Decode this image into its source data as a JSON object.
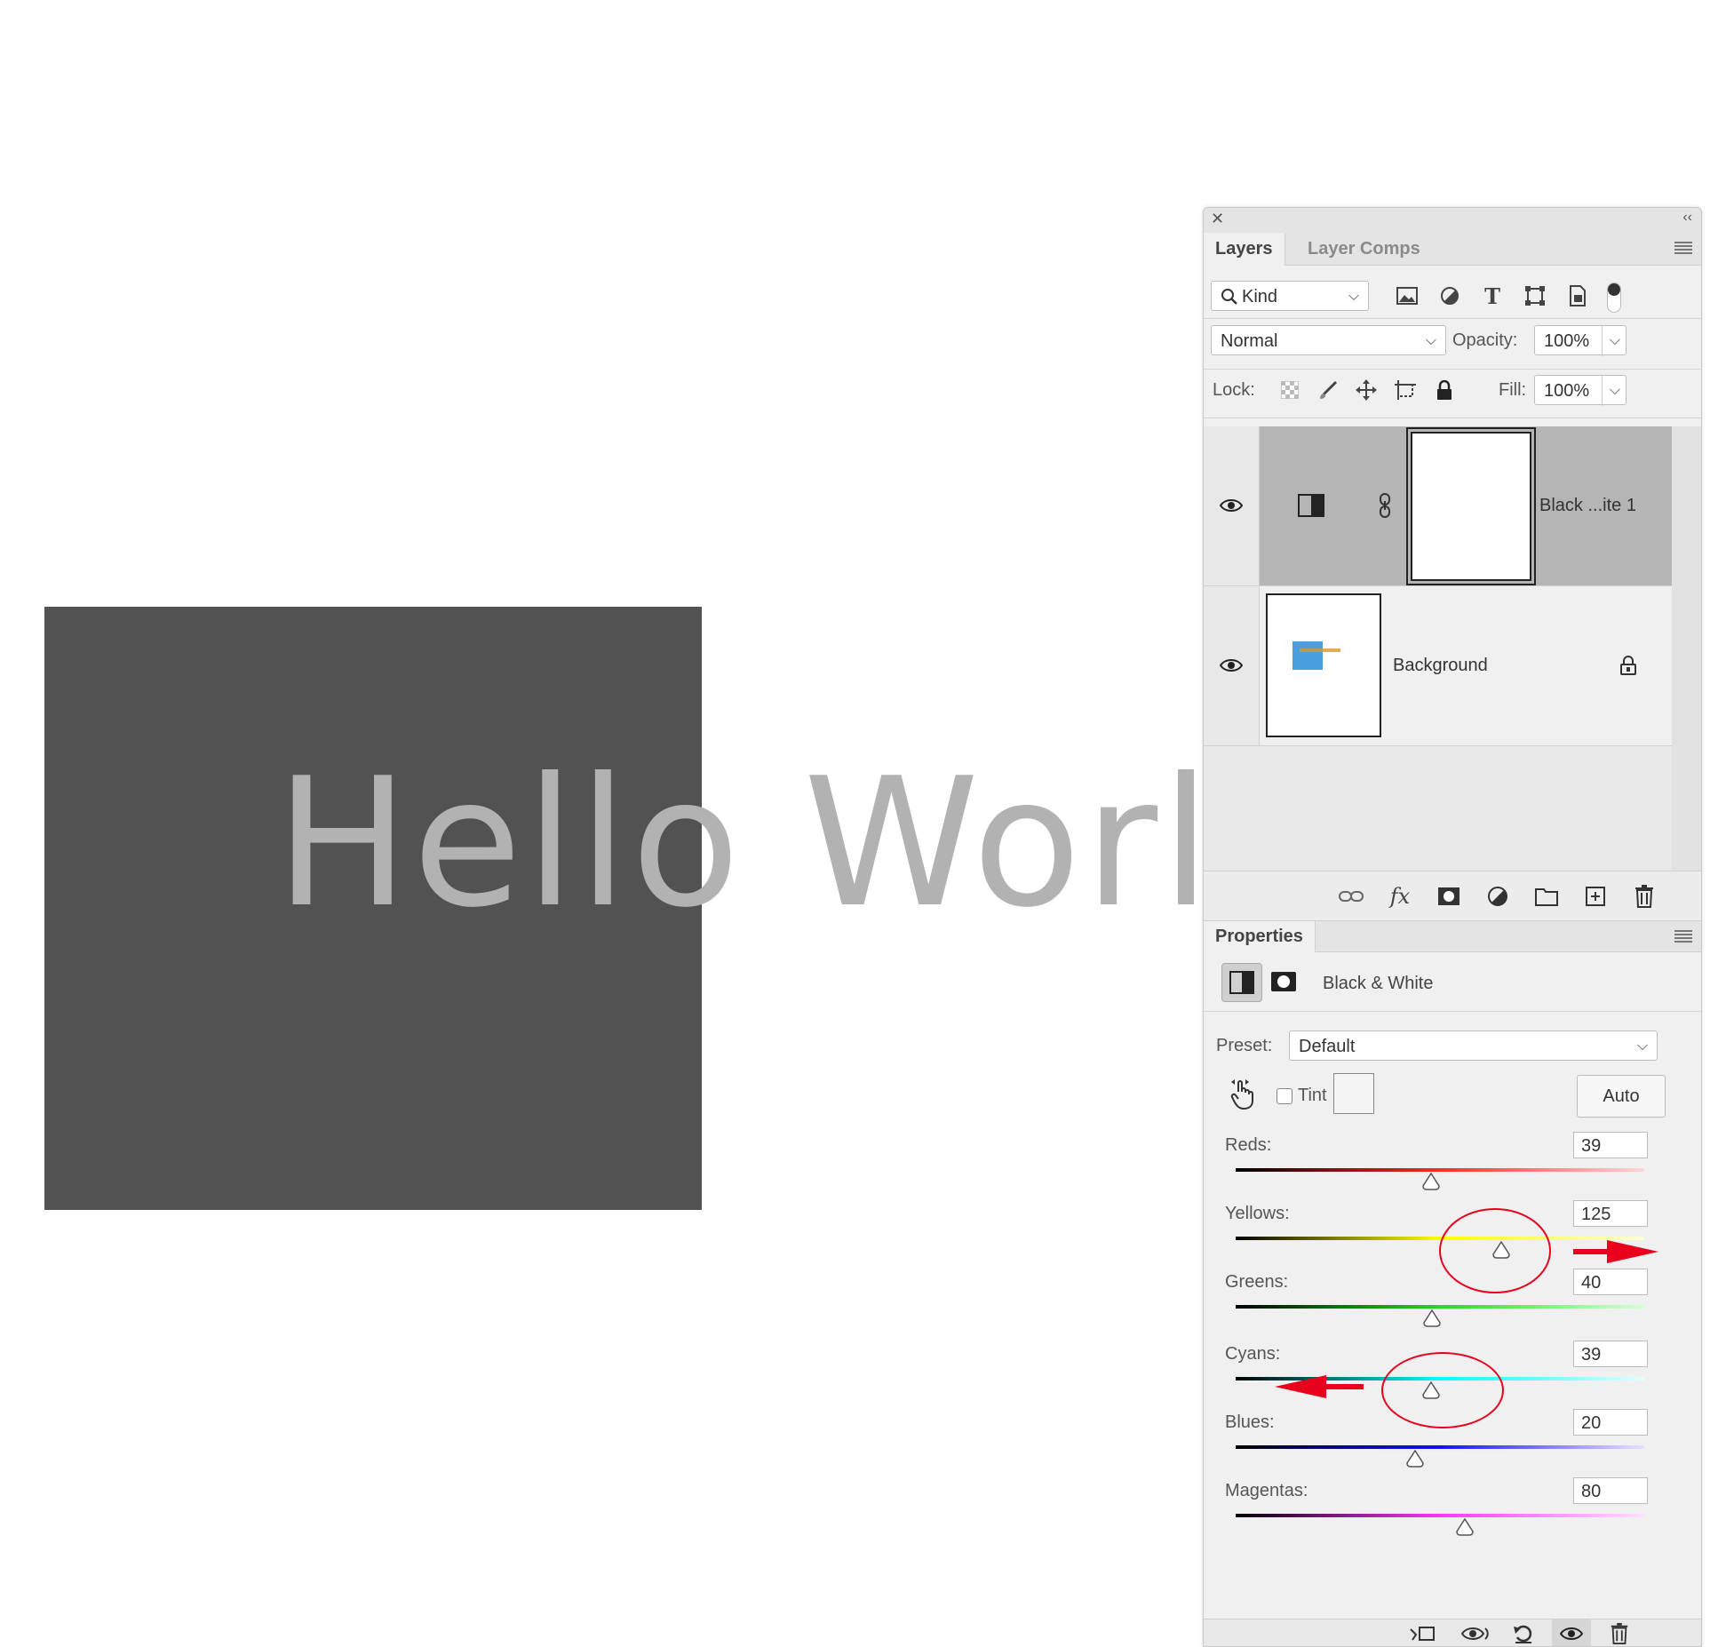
{
  "canvas": {
    "text": "Hello World"
  },
  "layers_panel": {
    "tabs": [
      "Layers",
      "Layer Comps"
    ],
    "filter": {
      "label": "Kind"
    },
    "blend_mode": "Normal",
    "opacity_label": "Opacity:",
    "opacity_value": "100%",
    "lock_label": "Lock:",
    "fill_label": "Fill:",
    "fill_value": "100%",
    "layers": [
      {
        "name": "Black ...ite 1",
        "selected": true,
        "type": "adjustment"
      },
      {
        "name": "Background",
        "locked": true
      }
    ]
  },
  "properties_panel": {
    "tab": "Properties",
    "adjustment_name": "Black & White",
    "preset_label": "Preset:",
    "preset_value": "Default",
    "tint_label": "Tint",
    "tint_checked": false,
    "auto_button": "Auto",
    "sliders": [
      {
        "label": "Reds:",
        "value": "39",
        "colors": [
          "#000000",
          "#ff2a2a",
          "#ffd6d6"
        ]
      },
      {
        "label": "Yellows:",
        "value": "125",
        "colors": [
          "#000000",
          "#ffff00",
          "#ffffd8"
        ]
      },
      {
        "label": "Greens:",
        "value": "40",
        "colors": [
          "#000000",
          "#22dd22",
          "#d8ffd8"
        ]
      },
      {
        "label": "Cyans:",
        "value": "39",
        "colors": [
          "#000000",
          "#00ffff",
          "#e0ffff"
        ]
      },
      {
        "label": "Blues:",
        "value": "20",
        "colors": [
          "#000000",
          "#1010ff",
          "#e8e0ff"
        ]
      },
      {
        "label": "Magentas:",
        "value": "80",
        "colors": [
          "#000000",
          "#ff33ff",
          "#ffe0ff"
        ]
      }
    ]
  },
  "annotation_color": "#e8001c",
  "icons": {
    "layers_footer": [
      "link-icon",
      "fx-icon",
      "mask-icon",
      "adjustment-icon",
      "folder-icon",
      "new-layer-icon",
      "trash-icon"
    ],
    "properties_footer": [
      "clip-icon",
      "view-previous-icon",
      "reset-icon",
      "visibility-icon",
      "trash-icon"
    ]
  }
}
